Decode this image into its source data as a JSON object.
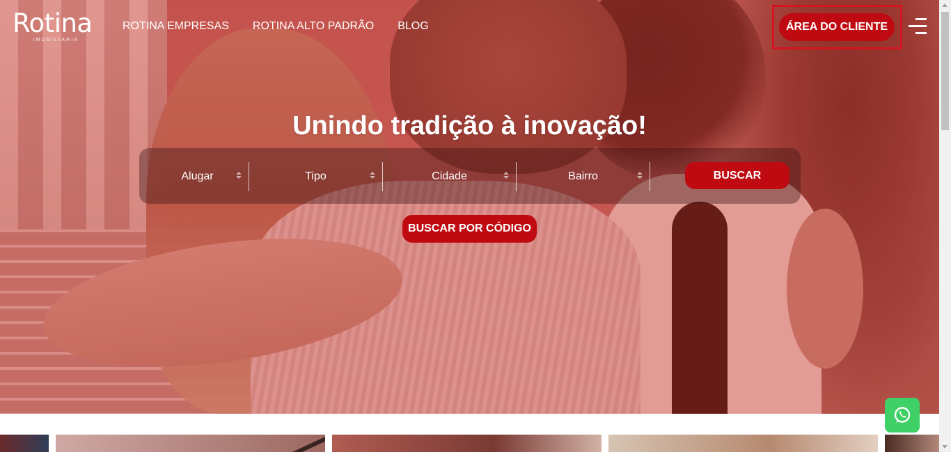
{
  "header": {
    "logo": {
      "name": "Rotina",
      "tagline": "IMOBILIARIA"
    },
    "nav": [
      {
        "label": "ROTINA EMPRESAS"
      },
      {
        "label": "ROTINA ALTO PADRÃO"
      },
      {
        "label": "BLOG"
      }
    ],
    "client_area_label": "ÁREA DO CLIENTE",
    "menu_icon": "hamburger-icon"
  },
  "hero": {
    "headline": "Unindo tradição à inovação!",
    "search": {
      "fields": [
        {
          "selected": "Alugar"
        },
        {
          "selected": "Tipo"
        },
        {
          "selected": "Cidade"
        },
        {
          "selected": "Bairro"
        }
      ],
      "submit_label": "BUSCAR"
    },
    "code_search_label": "BUSCAR POR CÓDIGO"
  },
  "floating": {
    "whatsapp_icon": "whatsapp-icon"
  },
  "colors": {
    "brand_red": "#c00a12",
    "highlight_red": "#d4141f",
    "whatsapp_green": "#3fd167",
    "text_white": "#ffffff"
  }
}
